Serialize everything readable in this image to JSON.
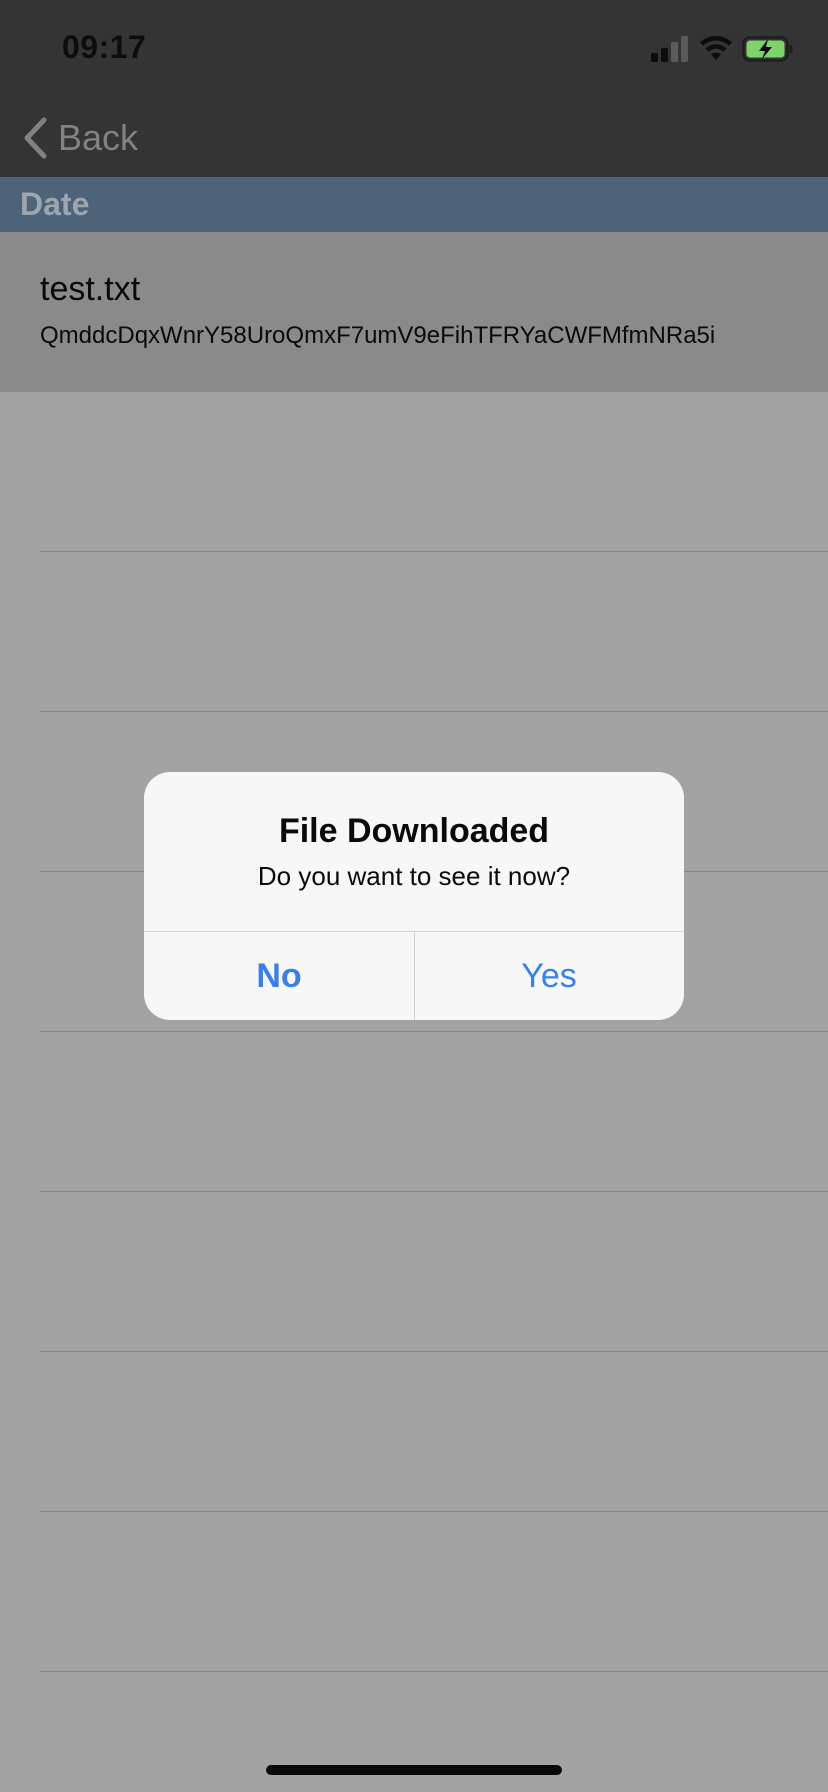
{
  "status_bar": {
    "time": "09:17",
    "signal_icon": "cellular-signal-icon",
    "wifi_icon": "wifi-icon",
    "battery_icon": "battery-charging-icon",
    "battery_color": "#7ed36b"
  },
  "nav": {
    "back_label": "Back",
    "back_icon": "chevron-left-icon"
  },
  "section": {
    "title": "Date"
  },
  "file": {
    "name": "test.txt",
    "hash": "QmddcDqxWnrY58UroQmxF7umV9eFihTFRYaCWFMfmNRa5i"
  },
  "alert": {
    "title": "File Downloaded",
    "message": "Do you want to see it now?",
    "no_label": "No",
    "yes_label": "Yes",
    "button_color": "#3a80e8"
  }
}
